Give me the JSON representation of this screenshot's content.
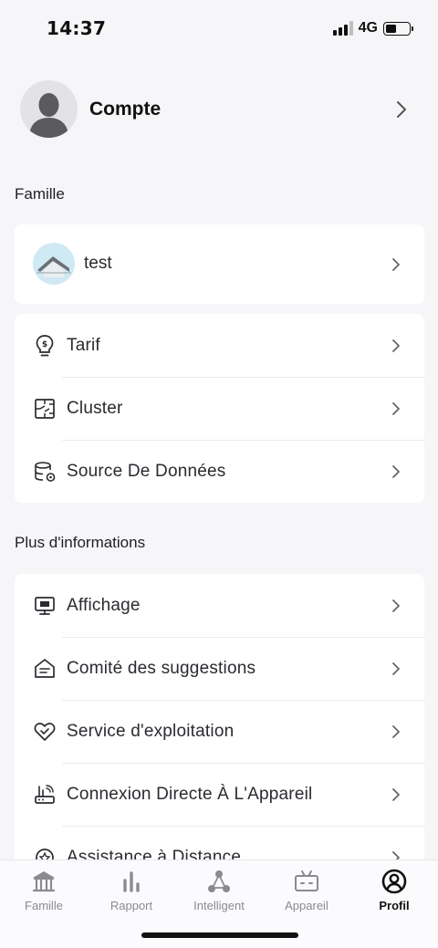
{
  "status_bar": {
    "time": "14:37",
    "network": "4G",
    "battery_level": 0.45
  },
  "account": {
    "label": "Compte"
  },
  "family_section": {
    "title": "Famille",
    "family_name": "test"
  },
  "settings": [
    {
      "label": "Tarif",
      "icon": "tariff-icon"
    },
    {
      "label": "Cluster",
      "icon": "cluster-icon"
    },
    {
      "label": "Source De Données",
      "icon": "data-source-icon"
    }
  ],
  "more_section": {
    "title": "Plus d'informations"
  },
  "more_items": [
    {
      "label": "Affichage",
      "icon": "display-icon"
    },
    {
      "label": "Comité des suggestions",
      "icon": "suggestions-icon"
    },
    {
      "label": "Service d'exploitation",
      "icon": "service-icon"
    },
    {
      "label": "Connexion Directe À L'Appareil",
      "icon": "router-icon"
    },
    {
      "label": "Assistance à Distance",
      "icon": "remote-assistance-icon"
    }
  ],
  "tabs": [
    {
      "label": "Famille",
      "icon": "home-icon",
      "active": false
    },
    {
      "label": "Rapport",
      "icon": "report-icon",
      "active": false
    },
    {
      "label": "Intelligent",
      "icon": "smart-icon",
      "active": false
    },
    {
      "label": "Appareil",
      "icon": "device-icon",
      "active": false
    },
    {
      "label": "Profil",
      "icon": "profile-icon",
      "active": true
    }
  ],
  "colors": {
    "background": "#f6f6f9",
    "card": "#ffffff",
    "text": "#1f1f24",
    "inactive_tab": "#8a8a90",
    "active_tab": "#111111"
  }
}
